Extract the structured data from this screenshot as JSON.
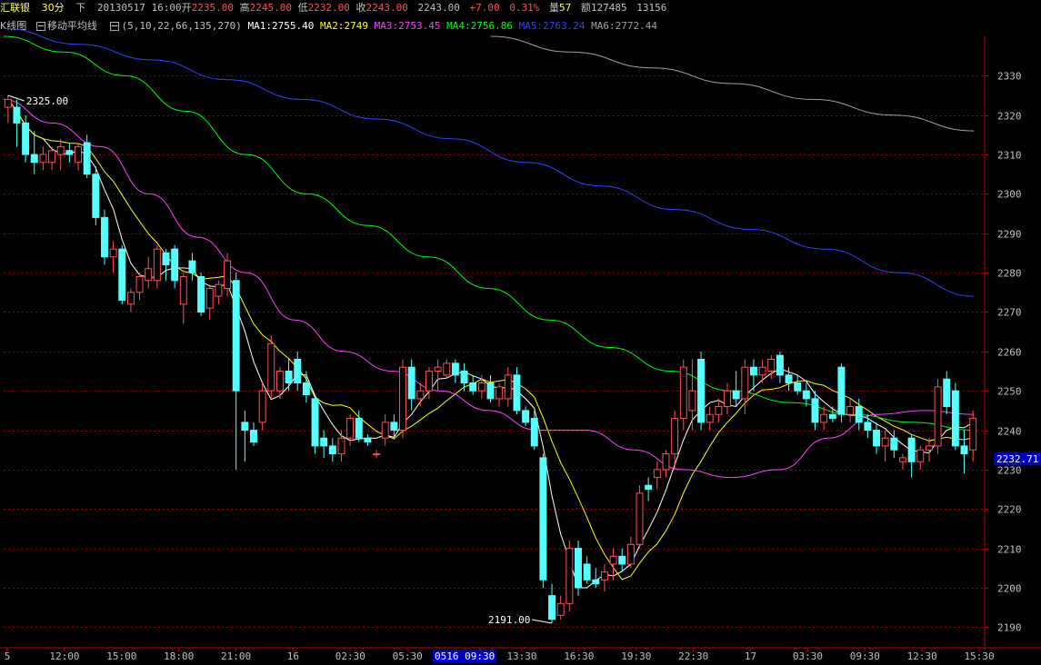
{
  "header": {
    "symbol": "汇联银",
    "period": "30分",
    "down_label": "下",
    "datetime": "20130517 16:00",
    "open_label": "开",
    "open": "2235.00",
    "high_label": "高",
    "high": "2245.00",
    "low_label": "低",
    "low": "2232.00",
    "close_label": "收",
    "close": "2243.00",
    "settle": "2243.00",
    "change": "+7.00",
    "change_pct": "0.31%",
    "volume_label": "量",
    "volume": "57",
    "amount_label": "额",
    "amount": "127485",
    "extra": "13156"
  },
  "ma_bar": {
    "kline_label": "K线图",
    "indicator_label": "移动平均线",
    "params": "(5,10,22,66,135,270)",
    "ma1": "MA1:2755.40",
    "ma2": "MA2:2749",
    "ma3": "MA3:2753.45",
    "ma4": "MA4:2756.86",
    "ma5": "MA5:2763.24",
    "ma6": "MA6:2772.44"
  },
  "colors": {
    "up": "#ff5252",
    "down": "#54ffff",
    "grid": "#9a0000",
    "axis": "#c00000",
    "ma1": "#ffffff",
    "ma2": "#ffff00",
    "ma3": "#ff40ff",
    "ma4": "#00ff00",
    "ma5": "#3040ff",
    "ma6": "#a0a0a0",
    "last_price_bg": "#0000c0"
  },
  "chart_data": {
    "type": "candlestick",
    "y_ticks": [
      2190,
      2200,
      2210,
      2220,
      2230,
      2240,
      2250,
      2260,
      2270,
      2280,
      2290,
      2300,
      2310,
      2320,
      2330
    ],
    "ylim": [
      2185,
      2340
    ],
    "x_ticks": [
      "5",
      "12:00",
      "15:00",
      "18:00",
      "21:00",
      "16",
      "02:30",
      "05:30",
      "0516 09:30",
      "13:30",
      "16:30",
      "19:30",
      "22:30",
      "17",
      "03:30",
      "09:30",
      "12:30",
      "15:30"
    ],
    "highlight_tick": "0516 09:30",
    "annotations": [
      {
        "label": "2325.00",
        "value": 2325
      },
      {
        "label": "2191.00",
        "value": 2191
      }
    ],
    "last_price": "2232.71",
    "candles": [
      {
        "o": 2322,
        "h": 2325,
        "l": 2318,
        "c": 2324
      },
      {
        "o": 2322,
        "h": 2324,
        "l": 2312,
        "c": 2318
      },
      {
        "o": 2318,
        "h": 2320,
        "l": 2308,
        "c": 2310
      },
      {
        "o": 2310,
        "h": 2316,
        "l": 2305,
        "c": 2308
      },
      {
        "o": 2308,
        "h": 2312,
        "l": 2306,
        "c": 2310
      },
      {
        "o": 2308,
        "h": 2312,
        "l": 2306,
        "c": 2311
      },
      {
        "o": 2310,
        "h": 2314,
        "l": 2306,
        "c": 2312
      },
      {
        "o": 2311,
        "h": 2313,
        "l": 2308,
        "c": 2310
      },
      {
        "o": 2308,
        "h": 2313,
        "l": 2306,
        "c": 2312
      },
      {
        "o": 2313,
        "h": 2315,
        "l": 2304,
        "c": 2305
      },
      {
        "o": 2305,
        "h": 2307,
        "l": 2292,
        "c": 2294
      },
      {
        "o": 2294,
        "h": 2296,
        "l": 2282,
        "c": 2284
      },
      {
        "o": 2284,
        "h": 2288,
        "l": 2280,
        "c": 2286
      },
      {
        "o": 2286,
        "h": 2287,
        "l": 2272,
        "c": 2273
      },
      {
        "o": 2272,
        "h": 2276,
        "l": 2270,
        "c": 2275
      },
      {
        "o": 2275,
        "h": 2280,
        "l": 2273,
        "c": 2279
      },
      {
        "o": 2278,
        "h": 2284,
        "l": 2276,
        "c": 2281
      },
      {
        "o": 2278,
        "h": 2287,
        "l": 2276,
        "c": 2286
      },
      {
        "o": 2285,
        "h": 2286,
        "l": 2278,
        "c": 2282
      },
      {
        "o": 2286,
        "h": 2287,
        "l": 2276,
        "c": 2278
      },
      {
        "o": 2272,
        "h": 2280,
        "l": 2267,
        "c": 2279
      },
      {
        "o": 2283,
        "h": 2285,
        "l": 2278,
        "c": 2280
      },
      {
        "o": 2279,
        "h": 2280,
        "l": 2269,
        "c": 2270
      },
      {
        "o": 2271,
        "h": 2277,
        "l": 2268,
        "c": 2276
      },
      {
        "o": 2274,
        "h": 2278,
        "l": 2272,
        "c": 2277
      },
      {
        "o": 2276,
        "h": 2285,
        "l": 2274,
        "c": 2283
      },
      {
        "o": 2278,
        "h": 2280,
        "l": 2230,
        "c": 2250
      },
      {
        "o": 2242,
        "h": 2245,
        "l": 2232,
        "c": 2240
      },
      {
        "o": 2240,
        "h": 2242,
        "l": 2236,
        "c": 2237
      },
      {
        "o": 2242,
        "h": 2252,
        "l": 2240,
        "c": 2250
      },
      {
        "o": 2250,
        "h": 2264,
        "l": 2248,
        "c": 2262
      },
      {
        "o": 2250,
        "h": 2256,
        "l": 2248,
        "c": 2255
      },
      {
        "o": 2255,
        "h": 2258,
        "l": 2250,
        "c": 2252
      },
      {
        "o": 2258,
        "h": 2260,
        "l": 2250,
        "c": 2252
      },
      {
        "o": 2252,
        "h": 2255,
        "l": 2247,
        "c": 2249
      },
      {
        "o": 2248,
        "h": 2249,
        "l": 2234,
        "c": 2236
      },
      {
        "o": 2238,
        "h": 2240,
        "l": 2233,
        "c": 2236
      },
      {
        "o": 2236,
        "h": 2238,
        "l": 2232,
        "c": 2234
      },
      {
        "o": 2234,
        "h": 2240,
        "l": 2232,
        "c": 2238
      },
      {
        "o": 2238,
        "h": 2244,
        "l": 2236,
        "c": 2243
      },
      {
        "o": 2243,
        "h": 2245,
        "l": 2237,
        "c": 2238
      },
      {
        "o": 2238,
        "h": 2239,
        "l": 2236,
        "c": 2237
      },
      {
        "o": 2234,
        "h": 2235,
        "l": 2233,
        "c": 2234
      },
      {
        "o": 2238,
        "h": 2244,
        "l": 2236,
        "c": 2242
      },
      {
        "o": 2242,
        "h": 2244,
        "l": 2238,
        "c": 2240
      },
      {
        "o": 2240,
        "h": 2258,
        "l": 2238,
        "c": 2256
      },
      {
        "o": 2256,
        "h": 2258,
        "l": 2245,
        "c": 2248
      },
      {
        "o": 2248,
        "h": 2252,
        "l": 2246,
        "c": 2250
      },
      {
        "o": 2250,
        "h": 2256,
        "l": 2248,
        "c": 2255
      },
      {
        "o": 2255,
        "h": 2258,
        "l": 2250,
        "c": 2256
      },
      {
        "o": 2254,
        "h": 2258,
        "l": 2253,
        "c": 2257
      },
      {
        "o": 2257,
        "h": 2258,
        "l": 2252,
        "c": 2254
      },
      {
        "o": 2255,
        "h": 2257,
        "l": 2250,
        "c": 2252
      },
      {
        "o": 2252,
        "h": 2254,
        "l": 2249,
        "c": 2250
      },
      {
        "o": 2250,
        "h": 2254,
        "l": 2248,
        "c": 2252
      },
      {
        "o": 2252,
        "h": 2254,
        "l": 2247,
        "c": 2248
      },
      {
        "o": 2248,
        "h": 2252,
        "l": 2246,
        "c": 2251
      },
      {
        "o": 2248,
        "h": 2256,
        "l": 2246,
        "c": 2254
      },
      {
        "o": 2254,
        "h": 2256,
        "l": 2244,
        "c": 2245
      },
      {
        "o": 2245,
        "h": 2246,
        "l": 2241,
        "c": 2242
      },
      {
        "o": 2243,
        "h": 2245,
        "l": 2235,
        "c": 2236
      },
      {
        "o": 2233,
        "h": 2234,
        "l": 2200,
        "c": 2202
      },
      {
        "o": 2198,
        "h": 2201,
        "l": 2191,
        "c": 2192
      },
      {
        "o": 2193,
        "h": 2198,
        "l": 2192,
        "c": 2196
      },
      {
        "o": 2196,
        "h": 2212,
        "l": 2194,
        "c": 2210
      },
      {
        "o": 2210,
        "h": 2212,
        "l": 2198,
        "c": 2200
      },
      {
        "o": 2206,
        "h": 2208,
        "l": 2201,
        "c": 2202
      },
      {
        "o": 2202,
        "h": 2205,
        "l": 2200,
        "c": 2201
      },
      {
        "o": 2202,
        "h": 2206,
        "l": 2199,
        "c": 2204
      },
      {
        "o": 2206,
        "h": 2210,
        "l": 2202,
        "c": 2208
      },
      {
        "o": 2208,
        "h": 2210,
        "l": 2204,
        "c": 2206
      },
      {
        "o": 2206,
        "h": 2213,
        "l": 2205,
        "c": 2211
      },
      {
        "o": 2211,
        "h": 2226,
        "l": 2210,
        "c": 2224
      },
      {
        "o": 2226,
        "h": 2228,
        "l": 2222,
        "c": 2225
      },
      {
        "o": 2228,
        "h": 2232,
        "l": 2225,
        "c": 2230
      },
      {
        "o": 2230,
        "h": 2235,
        "l": 2228,
        "c": 2234
      },
      {
        "o": 2234,
        "h": 2245,
        "l": 2230,
        "c": 2243
      },
      {
        "o": 2243,
        "h": 2258,
        "l": 2240,
        "c": 2256
      },
      {
        "o": 2245,
        "h": 2258,
        "l": 2240,
        "c": 2250
      },
      {
        "o": 2258,
        "h": 2260,
        "l": 2240,
        "c": 2242
      },
      {
        "o": 2242,
        "h": 2246,
        "l": 2240,
        "c": 2244
      },
      {
        "o": 2244,
        "h": 2248,
        "l": 2242,
        "c": 2246
      },
      {
        "o": 2246,
        "h": 2252,
        "l": 2244,
        "c": 2250
      },
      {
        "o": 2250,
        "h": 2255,
        "l": 2246,
        "c": 2248
      },
      {
        "o": 2248,
        "h": 2258,
        "l": 2244,
        "c": 2256
      },
      {
        "o": 2256,
        "h": 2258,
        "l": 2250,
        "c": 2254
      },
      {
        "o": 2254,
        "h": 2258,
        "l": 2252,
        "c": 2256
      },
      {
        "o": 2255,
        "h": 2259,
        "l": 2253,
        "c": 2258
      },
      {
        "o": 2259,
        "h": 2260,
        "l": 2252,
        "c": 2254
      },
      {
        "o": 2254,
        "h": 2256,
        "l": 2250,
        "c": 2252
      },
      {
        "o": 2252,
        "h": 2254,
        "l": 2249,
        "c": 2250
      },
      {
        "o": 2250,
        "h": 2252,
        "l": 2246,
        "c": 2248
      },
      {
        "o": 2248,
        "h": 2250,
        "l": 2240,
        "c": 2242
      },
      {
        "o": 2242,
        "h": 2246,
        "l": 2240,
        "c": 2244
      },
      {
        "o": 2244,
        "h": 2246,
        "l": 2242,
        "c": 2243
      },
      {
        "o": 2256,
        "h": 2257,
        "l": 2242,
        "c": 2244
      },
      {
        "o": 2244,
        "h": 2248,
        "l": 2242,
        "c": 2246
      },
      {
        "o": 2246,
        "h": 2248,
        "l": 2240,
        "c": 2242
      },
      {
        "o": 2242,
        "h": 2244,
        "l": 2238,
        "c": 2240
      },
      {
        "o": 2240,
        "h": 2242,
        "l": 2234,
        "c": 2236
      },
      {
        "o": 2236,
        "h": 2240,
        "l": 2232,
        "c": 2238
      },
      {
        "o": 2238,
        "h": 2240,
        "l": 2233,
        "c": 2235
      },
      {
        "o": 2232,
        "h": 2234,
        "l": 2230,
        "c": 2233
      },
      {
        "o": 2238,
        "h": 2239,
        "l": 2228,
        "c": 2232
      },
      {
        "o": 2232,
        "h": 2236,
        "l": 2230,
        "c": 2235
      },
      {
        "o": 2235,
        "h": 2238,
        "l": 2232,
        "c": 2236
      },
      {
        "o": 2236,
        "h": 2253,
        "l": 2234,
        "c": 2251
      },
      {
        "o": 2253,
        "h": 2255,
        "l": 2244,
        "c": 2246
      },
      {
        "o": 2250,
        "h": 2252,
        "l": 2235,
        "c": 2236
      },
      {
        "o": 2236,
        "h": 2240,
        "l": 2229,
        "c": 2234
      },
      {
        "o": 2235,
        "h": 2245,
        "l": 2232,
        "c": 2243
      }
    ],
    "ma_series": [
      {
        "name": "MA6",
        "color_key": "ma6",
        "x_start": 0.5,
        "x_end": 1.0,
        "values": [
          2340,
          2336,
          2332,
          2328,
          2324,
          2320,
          2316
        ]
      },
      {
        "name": "MA5",
        "color_key": "ma5",
        "x_start": 0.0,
        "x_end": 1.0,
        "values": [
          2342,
          2338,
          2334,
          2329,
          2324,
          2319,
          2314,
          2308,
          2302,
          2296,
          2291,
          2286,
          2280,
          2274
        ]
      },
      {
        "name": "MA4",
        "color_key": "ma4",
        "x_start": 0.0,
        "x_end": 1.0,
        "values": [
          2340,
          2336,
          2330,
          2321,
          2310,
          2300,
          2292,
          2284,
          2276,
          2268,
          2261,
          2255,
          2250,
          2247,
          2244,
          2242,
          2240
        ]
      },
      {
        "name": "MA3",
        "color_key": "ma3",
        "x_start": 0.0,
        "x_end": 1.0,
        "values": [
          2324,
          2318,
          2312,
          2300,
          2289,
          2280,
          2268,
          2260,
          2255,
          2250,
          2245,
          2240,
          2240,
          2235,
          2230,
          2228,
          2230,
          2238,
          2244,
          2245,
          2244
        ]
      }
    ]
  }
}
